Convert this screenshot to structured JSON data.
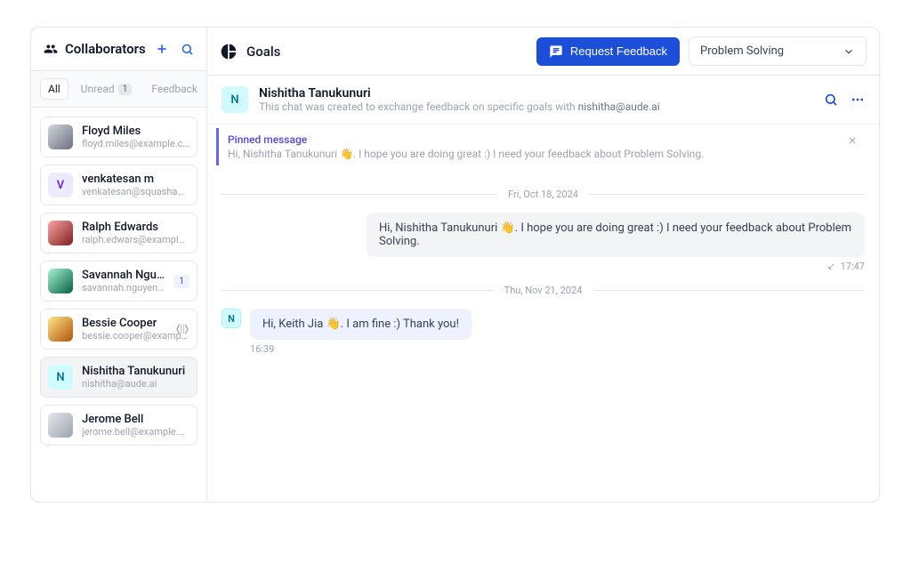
{
  "sidebar": {
    "title": "Collaborators",
    "tabs": {
      "all": "All",
      "unread": "Unread",
      "unread_count": "1",
      "feedback": "Feedback"
    },
    "items": [
      {
        "name": "Floyd Miles",
        "email": "floyd.miles@example.com",
        "initial": "",
        "avatar_class": "img",
        "avatar_bg": "linear-gradient(135deg,#d1d5db,#6b7280)"
      },
      {
        "name": "venkatesan m",
        "email": "venkatesan@squashapps…",
        "initial": "V",
        "avatar_class": "letter-V"
      },
      {
        "name": "Ralph Edwards",
        "email": "ralph.edwars@example.co…",
        "initial": "",
        "avatar_class": "img",
        "avatar_bg": "linear-gradient(135deg,#fca5a5,#7f1d1d)"
      },
      {
        "name": "Savannah Nguyen",
        "email": "savannah.nguyen@e…",
        "initial": "",
        "avatar_class": "img",
        "avatar_bg": "linear-gradient(135deg,#a7f3d0,#065f46)",
        "badge": "1"
      },
      {
        "name": "Bessie Cooper",
        "email": "bessie.cooper@example.c…",
        "initial": "",
        "avatar_class": "img",
        "avatar_bg": "linear-gradient(135deg,#fde68a,#b45309)"
      },
      {
        "name": "Nishitha Tanukunuri",
        "email": "nishitha@aude.ai",
        "initial": "N",
        "avatar_class": "letter-N",
        "selected": true
      },
      {
        "name": "Jerome Bell",
        "email": "jerome.bell@example.com",
        "initial": "",
        "avatar_class": "img",
        "avatar_bg": "linear-gradient(135deg,#e5e7eb,#9ca3af)"
      }
    ]
  },
  "header": {
    "title": "Goals",
    "request_btn": "Request Feedback",
    "select_value": "Problem Solving"
  },
  "chat": {
    "avatar_initial": "N",
    "name": "Nishitha Tanukunuri",
    "sub_prefix": "This chat was created to exchange feedback on specific goals with ",
    "sub_email": "nishitha@aude.ai",
    "pinned_title": "Pinned message",
    "pinned_text": "Hi, Nishitha Tanukunuri 👋. I hope you are doing great :) I need your feedback about Problem Solving.",
    "dates": {
      "d1": "Fri, Oct 18, 2024",
      "d2": "Thu, Nov 21, 2024"
    },
    "messages": {
      "m1_text": "Hi, Nishitha Tanukunuri 👋. I hope you are doing great :) I need your feedback about Problem Solving.",
      "m1_time": "17:47",
      "m2_avatar": "N",
      "m2_text": "Hi, Keith Jia 👋. I am fine :) Thank you!",
      "m2_time": "16:39"
    }
  }
}
